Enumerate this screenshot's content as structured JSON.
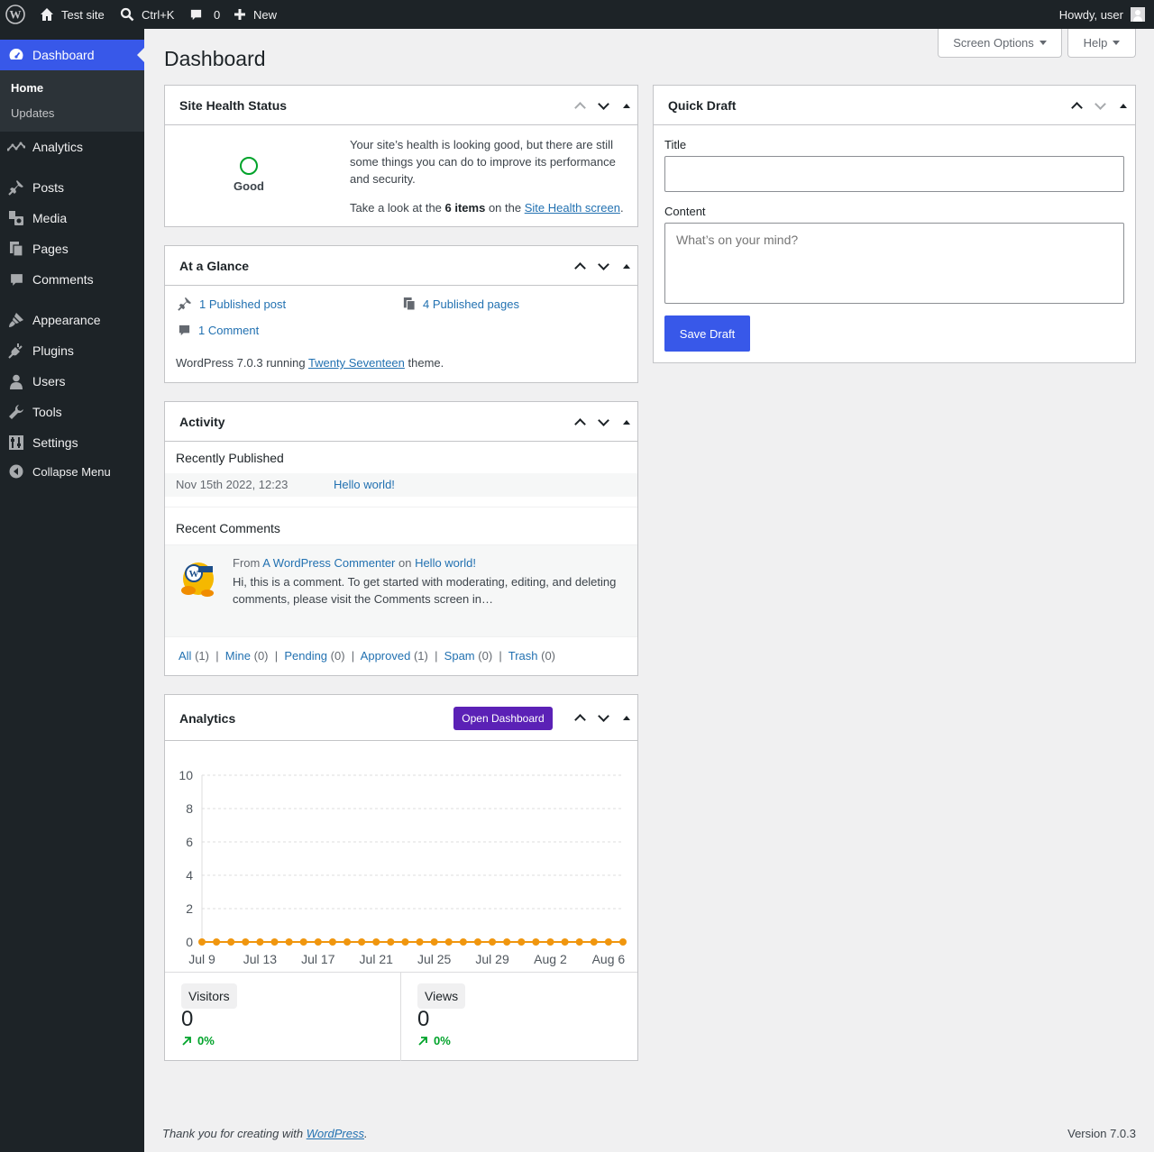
{
  "admin_bar": {
    "site_name": "Test site",
    "search_shortcut": "Ctrl+K",
    "comments_count": "0",
    "new_label": "New",
    "greeting": "Howdy, user"
  },
  "sidebar": {
    "items": [
      {
        "label": "Dashboard",
        "icon": "dashboard-icon",
        "current": true
      },
      {
        "label": "Analytics",
        "icon": "analytics-icon"
      },
      {
        "label": "Posts",
        "icon": "pin-icon"
      },
      {
        "label": "Media",
        "icon": "media-icon"
      },
      {
        "label": "Pages",
        "icon": "pages-icon"
      },
      {
        "label": "Comments",
        "icon": "comment-icon"
      },
      {
        "label": "Appearance",
        "icon": "brush-icon"
      },
      {
        "label": "Plugins",
        "icon": "plugin-icon"
      },
      {
        "label": "Users",
        "icon": "user-icon"
      },
      {
        "label": "Tools",
        "icon": "wrench-icon"
      },
      {
        "label": "Settings",
        "icon": "settings-icon"
      }
    ],
    "submenu": [
      "Home",
      "Updates"
    ],
    "collapse_label": "Collapse Menu"
  },
  "page": {
    "title": "Dashboard",
    "screen_options": "Screen Options",
    "help": "Help"
  },
  "site_health": {
    "title": "Site Health Status",
    "status": "Good",
    "message": "Your site’s health is looking good, but there are still some things you can do to improve its performance and security.",
    "look_prefix": "Take a look at the ",
    "items": "6 items",
    "look_middle": " on the ",
    "link": "Site Health screen",
    "look_suffix": "."
  },
  "at_a_glance": {
    "title": "At a Glance",
    "posts": "1 Published post",
    "pages": "4 Published pages",
    "comments": "1 Comment",
    "wp_prefix": "WordPress 7.0.3 running ",
    "theme": "Twenty Seventeen",
    "wp_suffix": " theme."
  },
  "activity": {
    "title": "Activity",
    "recently_published": "Recently Published",
    "post_date": "Nov 15th 2022, 12:23",
    "post_title": "Hello world!",
    "recent_comments": "Recent Comments",
    "comment_from": "From ",
    "commenter": "A WordPress Commenter",
    "comment_on": " on ",
    "comment_post": "Hello world!",
    "comment_text": "Hi, this is a comment. To get started with moderating, editing, and deleting comments, please visit the Comments screen in…",
    "filters": [
      {
        "label": "All",
        "count": "(1)"
      },
      {
        "label": "Mine",
        "count": "(0)"
      },
      {
        "label": "Pending",
        "count": "(0)"
      },
      {
        "label": "Approved",
        "count": "(1)"
      },
      {
        "label": "Spam",
        "count": "(0)"
      },
      {
        "label": "Trash",
        "count": "(0)"
      }
    ]
  },
  "analytics": {
    "title": "Analytics",
    "open_button": "Open Dashboard",
    "visitors_label": "Visitors",
    "visitors_value": "0",
    "visitors_change": "0%",
    "views_label": "Views",
    "views_value": "0",
    "views_change": "0%"
  },
  "chart_data": {
    "type": "line",
    "x_ticks": [
      "Jul 9",
      "Jul 13",
      "Jul 17",
      "Jul 21",
      "Jul 25",
      "Jul 29",
      "Aug 2",
      "Aug 6"
    ],
    "y_ticks": [
      "0",
      "2",
      "4",
      "6",
      "8",
      "10"
    ],
    "ylim": [
      0,
      10
    ],
    "series": [
      {
        "color": "#f0960e",
        "values": [
          0,
          0,
          0,
          0,
          0,
          0,
          0,
          0,
          0,
          0,
          0,
          0,
          0,
          0,
          0,
          0,
          0,
          0,
          0,
          0,
          0,
          0,
          0,
          0,
          0,
          0,
          0,
          0,
          0,
          0
        ]
      }
    ],
    "grid": true
  },
  "quick_draft": {
    "title": "Quick Draft",
    "title_label": "Title",
    "content_label": "Content",
    "content_placeholder": "What’s on your mind?",
    "save_button": "Save Draft"
  },
  "footer": {
    "thanks_prefix": "Thank you for creating with ",
    "wp_link": "WordPress",
    "thanks_suffix": ".",
    "version": "Version 7.0.3"
  }
}
